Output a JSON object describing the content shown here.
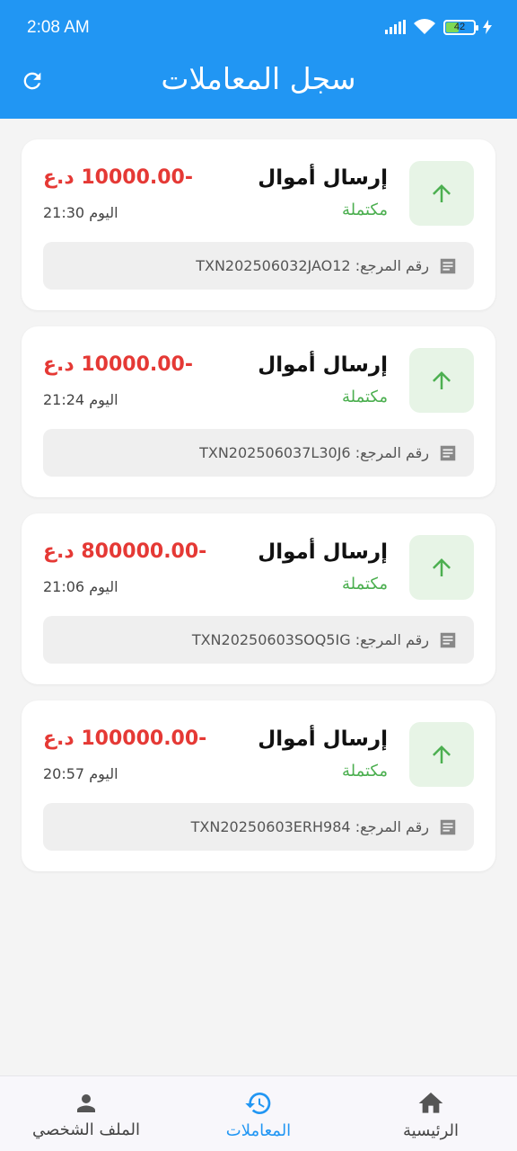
{
  "status_bar": {
    "time": "2:08 AM",
    "battery": "42"
  },
  "app_bar": {
    "title": "سجل المعاملات"
  },
  "transactions": [
    {
      "title": "إرسال أموال",
      "status": "مكتملة",
      "amount": "-10000.00 د.ع",
      "time": "اليوم 21:30",
      "ref_label": "رقم المرجع:",
      "ref": "TXN202506032JAO12"
    },
    {
      "title": "إرسال أموال",
      "status": "مكتملة",
      "amount": "-10000.00 د.ع",
      "time": "اليوم 21:24",
      "ref_label": "رقم المرجع:",
      "ref": "TXN202506037L30J6"
    },
    {
      "title": "إرسال أموال",
      "status": "مكتملة",
      "amount": "-800000.00 د.ع",
      "time": "اليوم 21:06",
      "ref_label": "رقم المرجع:",
      "ref": "TXN20250603SOQ5IG"
    },
    {
      "title": "إرسال أموال",
      "status": "مكتملة",
      "amount": "-100000.00 د.ع",
      "time": "اليوم 20:57",
      "ref_label": "رقم المرجع:",
      "ref": "TXN20250603ERH984"
    }
  ],
  "bottom_nav": {
    "profile": "الملف الشخصي",
    "transactions": "المعاملات",
    "home": "الرئيسية"
  },
  "colors": {
    "primary": "#2196f3",
    "success": "#4caf50",
    "danger": "#e53935"
  }
}
